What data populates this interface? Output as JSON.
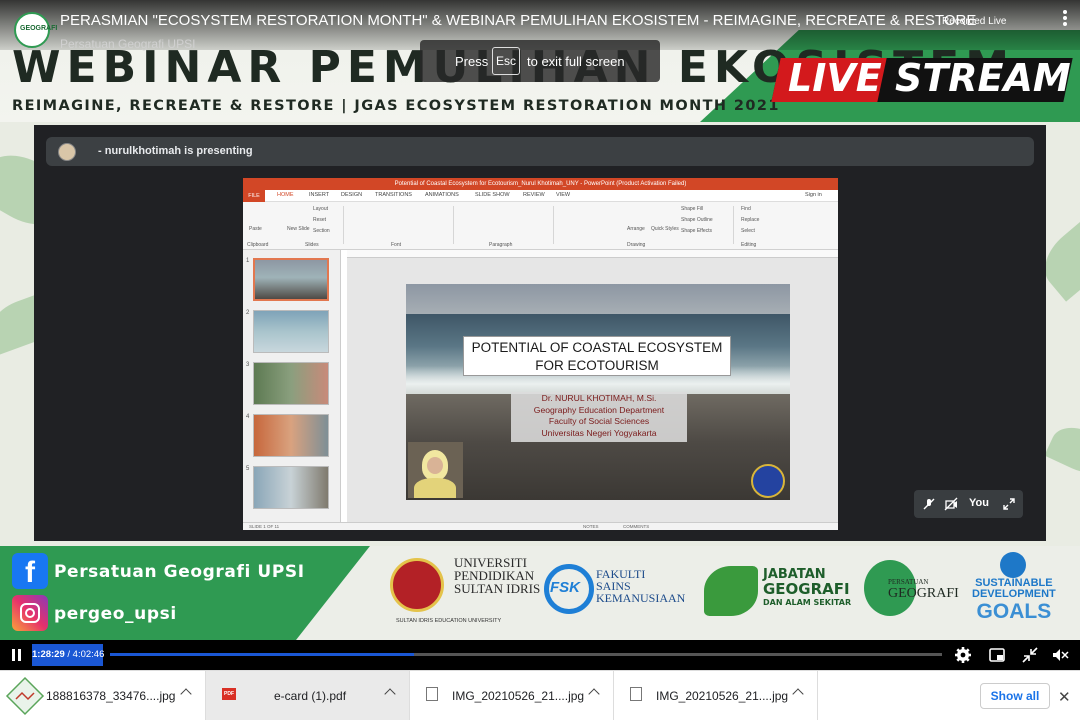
{
  "video": {
    "title": "PERASMIAN \"ECOSYSTEM RESTORATION MONTH\" & WEBINAR PEMULIHAN EKOSISTEM - REIMAGINE, RECREATE & RESTORE",
    "channel": "Persatuan Geografi UPSI",
    "badge": "Recorded Live",
    "channel_avatar_text": "GEOGRAFI"
  },
  "fullscreen_hint": {
    "press": "Press",
    "key": "Esc",
    "rest": "to exit full screen"
  },
  "banner": {
    "title": "WEBINAR PEMULIHAN EKOSISTEM",
    "subtitle": "REIMAGINE, RECREATE & RESTORE  |  JGAS ECOSYSTEM RESTORATION MONTH 2021",
    "live_label": "LIVE STREAM",
    "facebook": "Persatuan Geografi UPSI",
    "instagram": "pergeo_upsi",
    "logos": {
      "upsi_line1": "UNIVERSITI",
      "upsi_line2": "PENDIDIKAN",
      "upsi_line3": "SULTAN IDRIS",
      "upsi_caption": "SULTAN IDRIS EDUCATION UNIVERSITY",
      "fsk_mark": "FSK",
      "fsk_line1": "FAKULTI",
      "fsk_line2": "SAINS",
      "fsk_line3": "KEMANUSIAAN",
      "jgas_line1": "JABATAN",
      "jgas_line2": "GEOGRAFI",
      "jgas_line3": "DAN ALAM SEKITAR",
      "pg_line1": "PERSATUAN",
      "pg_line2": "GEOGRAFI",
      "sdg_line1": "SUSTAINABLE",
      "sdg_line2": "DEVELOPMENT",
      "sdg_line3": "GOALS"
    }
  },
  "meet": {
    "presenting": "- nurulkhotimah is presenting",
    "self_label": "You"
  },
  "powerpoint": {
    "window_title": "Potential of Coastal Ecosystem for Ecotourism_Nurul Khotimah_UNY - PowerPoint (Product Activation Failed)",
    "sign_in": "Sign in",
    "tabs": [
      "FILE",
      "HOME",
      "INSERT",
      "DESIGN",
      "TRANSITIONS",
      "ANIMATIONS",
      "SLIDE SHOW",
      "REVIEW",
      "VIEW"
    ],
    "ribbon": {
      "paste": "Paste",
      "new_slide": "New Slide",
      "layout": "Layout",
      "reset": "Reset",
      "section": "Section",
      "clipboard": "Clipboard",
      "slides": "Slides",
      "font": "Font",
      "paragraph": "Paragraph",
      "drawing": "Drawing",
      "editing": "Editing",
      "arrange": "Arrange",
      "quick_styles": "Quick Styles",
      "shape_fill": "Shape Fill",
      "shape_outline": "Shape Outline",
      "shape_effects": "Shape Effects",
      "find": "Find",
      "replace": "Replace",
      "select": "Select"
    },
    "thumb_numbers": [
      "1",
      "2",
      "3",
      "4",
      "5"
    ],
    "slide": {
      "title_line1": "POTENTIAL OF COASTAL ECOSYSTEM",
      "title_line2": "FOR ECOTOURISM",
      "author": "Dr. NURUL KHOTIMAH, M.Si.",
      "dept": "Geography Education Department",
      "faculty": "Faculty of Social Sciences",
      "university": "Universitas Negeri Yogyakarta"
    },
    "status": {
      "slide_of": "SLIDE 1 OF 11",
      "notes": "NOTES",
      "comments": "COMMENTS"
    }
  },
  "player": {
    "current_time": "1:28:29",
    "duration": "4:02:46",
    "time_separator": " / ",
    "progress_fraction": 0.3648
  },
  "downloads": {
    "items": [
      {
        "name": "188816378_33476....jpg",
        "type": "jpg"
      },
      {
        "name": "e-card (1).pdf",
        "type": "pdf"
      },
      {
        "name": "IMG_20210526_21....jpg",
        "type": "jpg"
      },
      {
        "name": "IMG_20210526_21....jpg",
        "type": "jpg"
      }
    ],
    "show_all": "Show all",
    "close": "✕"
  },
  "colors": {
    "brand_green": "#2f9a52",
    "live_red": "#d3191c",
    "player_blue": "#1a57d4",
    "powerpoint_orange": "#d24726"
  }
}
